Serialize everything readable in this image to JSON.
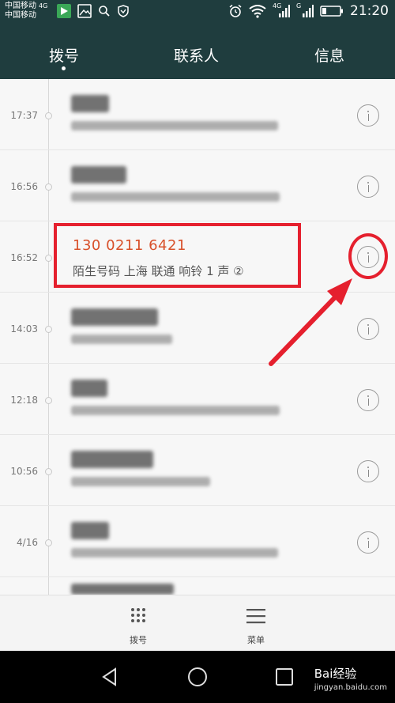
{
  "status_bar": {
    "carrier1": "中国移动",
    "network1": "4G",
    "carrier2": "中国移动",
    "signal_label_4g": "4G",
    "signal_label_g": "G",
    "time": "21:20",
    "icons_left": [
      "play-store-icon",
      "gallery-icon",
      "search-icon",
      "shield-icon"
    ],
    "icons_right": [
      "alarm-icon",
      "wifi-icon",
      "signal-icon",
      "signal-icon",
      "battery-icon"
    ]
  },
  "tabs": [
    {
      "label": "拨号",
      "active": true
    },
    {
      "label": "联系人",
      "active": false
    },
    {
      "label": "信息",
      "active": false
    }
  ],
  "calls": [
    {
      "time": "17:37",
      "blurred": true
    },
    {
      "time": "16:56",
      "blurred": true
    },
    {
      "time": "16:52",
      "blurred": false,
      "number": "130 0211 6421",
      "detail": "陌生号码  上海 联通  响铃 1 声 ②"
    },
    {
      "time": "14:03",
      "blurred": true
    },
    {
      "time": "12:18",
      "blurred": true
    },
    {
      "time": "10:56",
      "blurred": true
    },
    {
      "time": "4/16",
      "blurred": true
    }
  ],
  "action_bar": {
    "dial_label": "拨号",
    "menu_label": "菜单"
  },
  "watermark": {
    "brand": "Bai经验",
    "url": "jingyan.baidu.com"
  },
  "colors": {
    "header_bg": "#1f3d3e",
    "highlight_red": "#e5202e",
    "number_orange": "#d8502a"
  }
}
